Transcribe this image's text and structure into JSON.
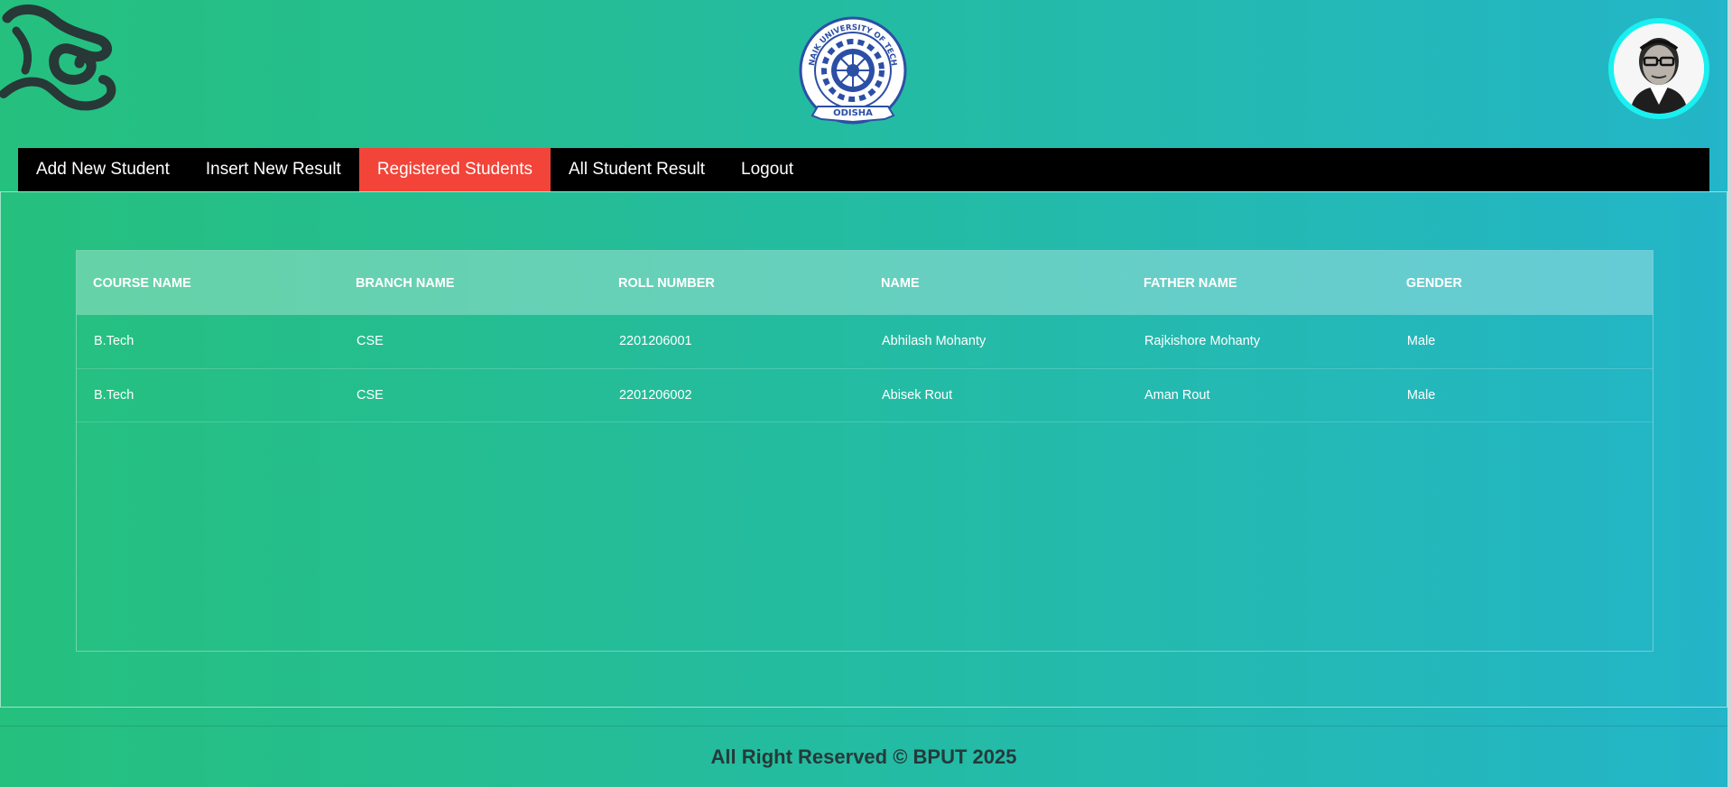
{
  "header": {
    "left_logo_icon": "swirl-logo-icon",
    "center_logo": {
      "icon": "university-seal-icon",
      "arc_text": "BIJU PATNAIK UNIVERSITY OF TECHNOLOGY",
      "banner_text": "ODISHA"
    },
    "avatar_icon": "profile-avatar-icon"
  },
  "nav": {
    "items": [
      {
        "label": "Add New Student",
        "active": false
      },
      {
        "label": "Insert New Result",
        "active": false
      },
      {
        "label": "Registered Students",
        "active": true
      },
      {
        "label": "All Student Result",
        "active": false
      },
      {
        "label": "Logout",
        "active": false
      }
    ],
    "active_color": "#f24438",
    "bar_color": "#000000"
  },
  "table": {
    "columns": [
      "COURSE NAME",
      "BRANCH NAME",
      "ROLL NUMBER",
      "NAME",
      "FATHER NAME",
      "GENDER"
    ],
    "rows": [
      [
        "B.Tech",
        "CSE",
        "2201206001",
        "Abhilash Mohanty",
        "Rajkishore Mohanty",
        "Male"
      ],
      [
        "B.Tech",
        "CSE",
        "2201206002",
        "Abisek Rout",
        "Aman Rout",
        "Male"
      ]
    ]
  },
  "footer": {
    "text": "All Right Reserved © BPUT 2025"
  },
  "colors": {
    "gradient_start": "#25c07e",
    "gradient_end": "#23b5c8",
    "avatar_border": "#19f0f0"
  }
}
